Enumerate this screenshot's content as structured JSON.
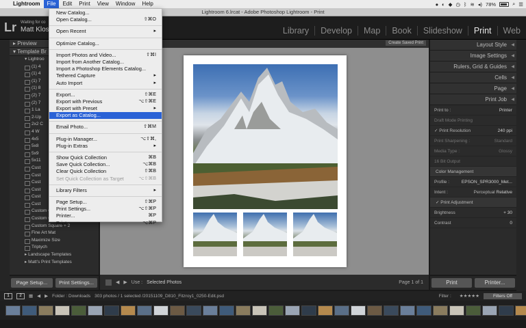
{
  "menubar": {
    "app": "Lightroom",
    "items": [
      "File",
      "Edit",
      "Print",
      "View",
      "Window",
      "Help"
    ],
    "battery": "78%"
  },
  "window": {
    "title": "Lightroom 6.lrcat - Adobe Photoshop Lightroom - Print"
  },
  "identity": {
    "logo": "Lr",
    "line1": "Waiting for co",
    "line2": "Matt Klos"
  },
  "modules": [
    "Library",
    "Develop",
    "Map",
    "Book",
    "Slideshow",
    "Print",
    "Web"
  ],
  "left_panel": {
    "preview": "Preview",
    "template_browser": "Template Br",
    "group": "Lightroo",
    "items": [
      "(1) 4",
      "(1) 4",
      "(1) 7",
      "(1) 8",
      "(2) 7",
      "(2) 7",
      "1 La",
      "2-Up",
      "2x2 C",
      "4 W",
      "4x5",
      "5x8",
      "5x9",
      "5x11",
      "Cust",
      "Cust",
      "Cust",
      "Cust",
      "Cust",
      "Cust",
      "Custom Overlap x3 Border",
      "Custom Overlap x3 Landscape",
      "Custom Square + 2",
      "Fine Art Mat",
      "Maximize Size",
      "Triptych"
    ],
    "landscape": "Landscape Templates",
    "matt": "Matt's Print Templates",
    "page_setup": "Page Setup...",
    "print_settings": "Print Settings..."
  },
  "center": {
    "create_saved": "Create Saved Print",
    "use_label": "Use :",
    "use_value": "Selected Photos",
    "page_count": "Page 1 of 1"
  },
  "right_panel": {
    "sections": [
      "Layout Style",
      "Image Settings",
      "Rulers, Grid & Guides",
      "Cells",
      "Page",
      "Print Job"
    ],
    "print_to_label": "Print to :",
    "print_to_value": "Printer",
    "draft": "Draft Mode Printing",
    "resolution_label": "Print Resolution",
    "resolution_value": "240 ppi",
    "sharpening_label": "Print Sharpening :",
    "sharpening_value": "Standard",
    "media_label": "Media Type :",
    "media_value": "Glossy",
    "bit_output": "16 Bit Output",
    "color_mgmt": "Color Management",
    "profile_label": "Profile :",
    "profile_value": "EPSON_SPR3000_Met...",
    "intent_label": "Intent :",
    "intent_a": "Perceptual",
    "intent_b": "Relative",
    "adjust": "Print Adjustment",
    "brightness_label": "Brightness",
    "brightness_value": "+ 30",
    "contrast_label": "Contrast",
    "contrast_value": "0",
    "print_btn": "Print",
    "printer_btn": "Printer..."
  },
  "filmbar": {
    "pages": [
      "1",
      "2"
    ],
    "folder": "Folder : Downloads",
    "count": "303 photos / 1 selected /20151109_D810_Fitzroy1_0250-Edit.psd",
    "filter": "Filter :",
    "filters_off": "Filters Off"
  },
  "file_menu": {
    "items": [
      {
        "label": "New Catalog...",
        "sc": ""
      },
      {
        "label": "Open Catalog...",
        "sc": "⇧⌘O"
      },
      {
        "sep": true
      },
      {
        "label": "Open Recent",
        "sc": "▸"
      },
      {
        "sep": true
      },
      {
        "label": "Optimize Catalog...",
        "sc": ""
      },
      {
        "sep": true
      },
      {
        "label": "Import Photos and Video...",
        "sc": "⇧⌘I"
      },
      {
        "label": "Import from Another Catalog...",
        "sc": ""
      },
      {
        "label": "Import a Photoshop Elements Catalog...",
        "sc": ""
      },
      {
        "label": "Tethered Capture",
        "sc": "▸"
      },
      {
        "label": "Auto Import",
        "sc": "▸"
      },
      {
        "sep": true
      },
      {
        "label": "Export...",
        "sc": "⇧⌘E"
      },
      {
        "label": "Export with Previous",
        "sc": "⌥⇧⌘E"
      },
      {
        "label": "Export with Preset",
        "sc": "▸"
      },
      {
        "label": "Export as Catalog...",
        "sc": "",
        "hl": true
      },
      {
        "sep": true
      },
      {
        "label": "Email Photo...",
        "sc": "⇧⌘M"
      },
      {
        "sep": true
      },
      {
        "label": "Plug-in Manager...",
        "sc": "⌥⇧⌘,"
      },
      {
        "label": "Plug-in Extras",
        "sc": "▸"
      },
      {
        "sep": true
      },
      {
        "label": "Show Quick Collection",
        "sc": "⌘B"
      },
      {
        "label": "Save Quick Collection...",
        "sc": "⌥⌘B"
      },
      {
        "label": "Clear Quick Collection",
        "sc": "⇧⌘B"
      },
      {
        "label": "Set Quick Collection as Target",
        "sc": "⌥⇧⌘B",
        "disabled": true
      },
      {
        "sep": true
      },
      {
        "label": "Library Filters",
        "sc": "▸"
      },
      {
        "sep": true
      },
      {
        "label": "Page Setup...",
        "sc": "⇧⌘P"
      },
      {
        "label": "Print Settings...",
        "sc": "⌥⇧⌘P"
      },
      {
        "label": "Printer...",
        "sc": "⌘P"
      },
      {
        "label": "Print",
        "sc": "⌥⌘P"
      }
    ]
  },
  "colors": {
    "highlight": "#2a62d6",
    "panel": "#2b2b2b",
    "canvas": "#8e8e8e"
  }
}
